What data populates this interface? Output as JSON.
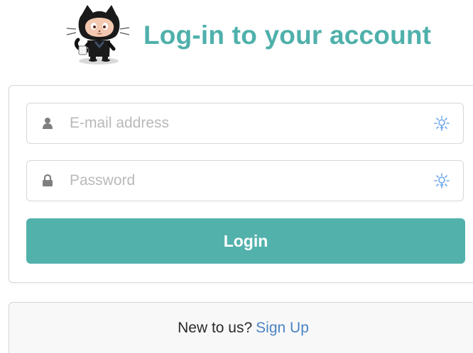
{
  "header": {
    "title": "Log-in to your account",
    "logo_icon": "octocat-icon"
  },
  "form": {
    "email": {
      "placeholder": "E-mail address",
      "value": "",
      "icon": "user-icon",
      "autofill_icon": "password-manager-icon"
    },
    "password": {
      "placeholder": "Password",
      "value": "",
      "icon": "lock-icon",
      "autofill_icon": "password-manager-icon"
    },
    "login_label": "Login"
  },
  "signup": {
    "prompt": "New to us?",
    "link_label": "Sign Up"
  },
  "colors": {
    "accent": "#53b1ab",
    "title": "#4fb0ab",
    "link": "#4a83c4",
    "autofill_icon": "#6fa8e8"
  }
}
